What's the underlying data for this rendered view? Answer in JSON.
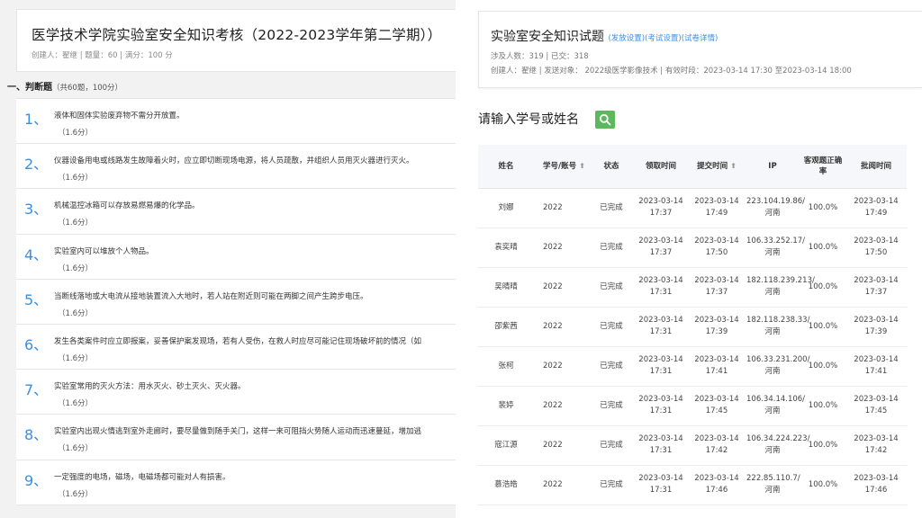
{
  "left": {
    "exam_title": "医学技术学院实验室安全知识考核（2022-2023学年第二学期））",
    "exam_meta": "创建人：翟继 | 题量：60 | 满分：100 分",
    "section_title": "一、判断题",
    "section_sub": "（共60题，100分）",
    "questions": [
      {
        "num": "1、",
        "text": "液体和固体实验废弃物不需分开放置。",
        "score": "（1.6分）"
      },
      {
        "num": "2、",
        "text": "仪器设备用电或线路发生故障着火时，应立即切断现场电源，将人员疏散，并组织人员用灭火器进行灭火。",
        "score": "（1.6分）"
      },
      {
        "num": "3、",
        "text": "机械温控冰箱可以存放易燃易爆的化学品。",
        "score": "（1.6分）"
      },
      {
        "num": "4、",
        "text": "实验室内可以堆放个人物品。",
        "score": "（1.6分）"
      },
      {
        "num": "5、",
        "text": "当断线落地或大电流从接地装置流入大地时，若人站在附近则可能在两脚之间产生跨步电压。",
        "score": "（1.6分）"
      },
      {
        "num": "6、",
        "text": "发生各类案件时应立即报案，妥善保护案发现场，若有人受伤，在救人时应尽可能记住现场破坏前的情况（如",
        "score": "（1.6分）"
      },
      {
        "num": "7、",
        "text": "实验室常用的灭火方法：用水灭火、砂土灭火、灭火器。",
        "score": "（1.6分）"
      },
      {
        "num": "8、",
        "text": "实验室内出现火情逃到室外走廊时，要尽量做到随手关门，这样一来可阻挡火势随人运动而迅速蔓延，增加逃",
        "score": "（1.6分）"
      },
      {
        "num": "9、",
        "text": "一定强度的电场，磁场，电磁场都可能对人有损害。",
        "score": "（1.6分）"
      }
    ]
  },
  "right": {
    "title": "实验室安全知识试题",
    "links": [
      "(发放设置)",
      "(考试设置)",
      "(试卷详情)"
    ],
    "counts": "涉及人数：319 | 已交：318",
    "details": "创建人：翟继 | 发送对象： 2022级医学影像技术 | 有效时段：2023-03-14 17:30 至2023-03-14 18:00",
    "search_placeholder": "请输入学号或姓名",
    "table": {
      "headers": {
        "name": "姓名",
        "id": "学号/账号",
        "status": "状态",
        "recv": "领取时间",
        "submit": "提交时间",
        "ip": "IP",
        "accuracy": "客观题正确率",
        "review": "批阅时间"
      },
      "rows": [
        {
          "name": "刘娜",
          "id": "2022",
          "status": "已完成",
          "recv": "2023-03-14 17:37",
          "submit": "2023-03-14 17:49",
          "ip": "223.104.19.86/河南",
          "accuracy": "100.0%",
          "review": "2023-03-14 17:49"
        },
        {
          "name": "袁奕晴",
          "id": "2022",
          "status": "已完成",
          "recv": "2023-03-14 17:37",
          "submit": "2023-03-14 17:50",
          "ip": "106.33.252.17/河南",
          "accuracy": "100.0%",
          "review": "2023-03-14 17:50"
        },
        {
          "name": "吴晴晴",
          "id": "2022",
          "status": "已完成",
          "recv": "2023-03-14 17:31",
          "submit": "2023-03-14 17:37",
          "ip": "182.118.239.213/河南",
          "accuracy": "100.0%",
          "review": "2023-03-14 17:37"
        },
        {
          "name": "邵紫茜",
          "id": "2022",
          "status": "已完成",
          "recv": "2023-03-14 17:31",
          "submit": "2023-03-14 17:39",
          "ip": "182.118.238.33/河南",
          "accuracy": "100.0%",
          "review": "2023-03-14 17:39"
        },
        {
          "name": "张柯",
          "id": "2022",
          "status": "已完成",
          "recv": "2023-03-14 17:31",
          "submit": "2023-03-14 17:41",
          "ip": "106.33.231.200/河南",
          "accuracy": "100.0%",
          "review": "2023-03-14 17:41"
        },
        {
          "name": "裴婷",
          "id": "2022",
          "status": "已完成",
          "recv": "2023-03-14 17:31",
          "submit": "2023-03-14 17:45",
          "ip": "106.34.14.106/河南",
          "accuracy": "100.0%",
          "review": "2023-03-14 17:45"
        },
        {
          "name": "寇江源",
          "id": "2022",
          "status": "已完成",
          "recv": "2023-03-14 17:31",
          "submit": "2023-03-14 17:42",
          "ip": "106.34.224.223/河南",
          "accuracy": "100.0%",
          "review": "2023-03-14 17:42"
        },
        {
          "name": "慕浩皓",
          "id": "2022",
          "status": "已完成",
          "recv": "2023-03-14 17:31",
          "submit": "2023-03-14 17:46",
          "ip": "222.85.110.7/河南",
          "accuracy": "100.0%",
          "review": "2023-03-14 17:46"
        }
      ]
    }
  },
  "colors": {
    "accent_blue": "#3a8ee6",
    "search_green": "#5cb85c",
    "panel_bg": "#f2f2f2",
    "header_bg": "#f5f7fa"
  }
}
